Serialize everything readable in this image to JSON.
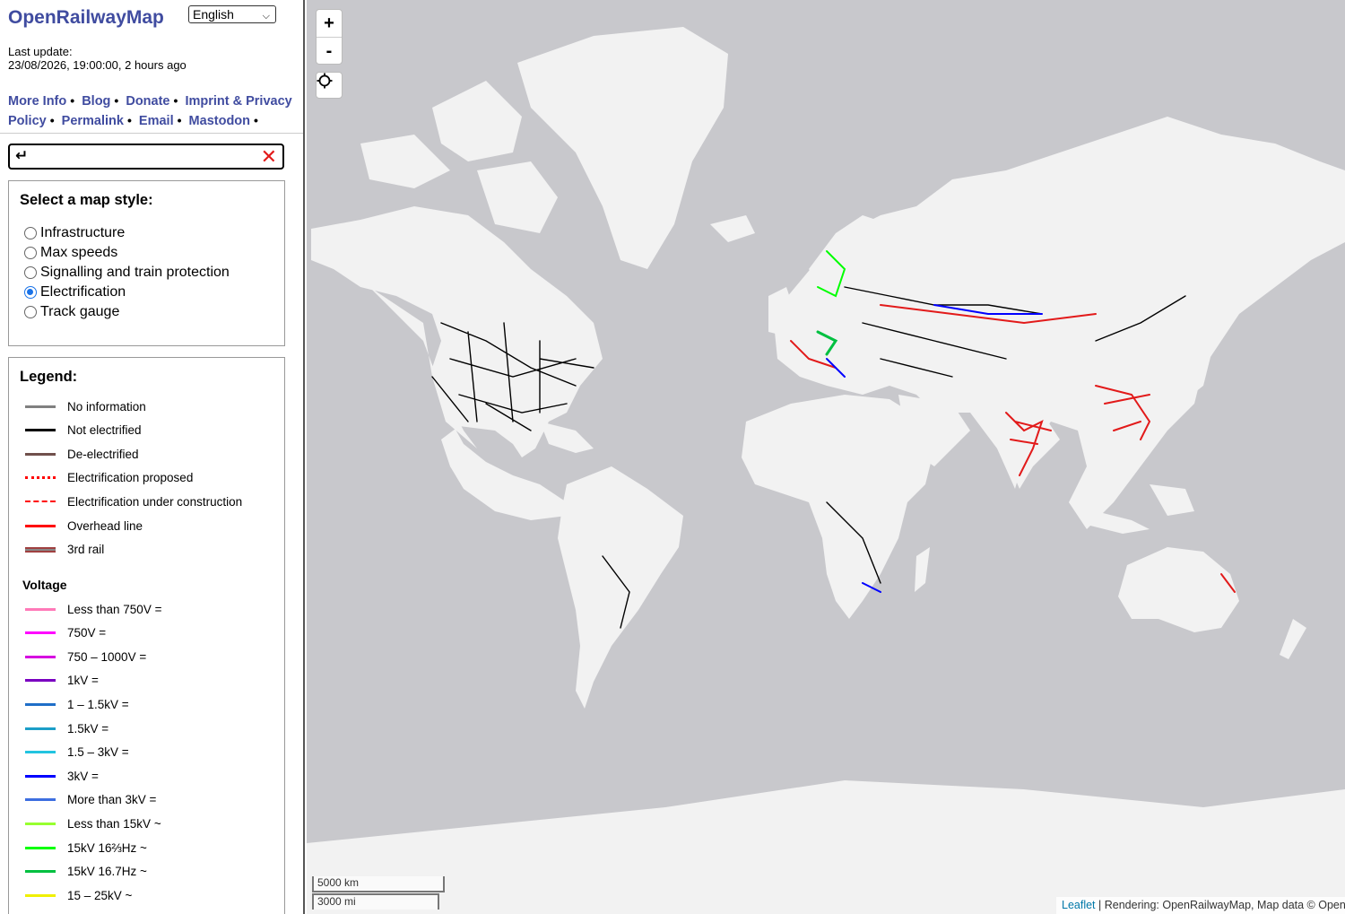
{
  "header": {
    "title": "OpenRailwayMap",
    "language": "English"
  },
  "last_update": {
    "label": "Last update:",
    "value": "23/08/2026, 19:00:00, 2 hours ago"
  },
  "links": [
    "More Info",
    "Blog",
    "Donate",
    "Imprint & Privacy Policy",
    "Permalink",
    "Email",
    "Mastodon"
  ],
  "search": {
    "enter_icon": "↵",
    "value": "",
    "clear_icon": "✕"
  },
  "map_style": {
    "heading": "Select a map style:",
    "options": [
      "Infrastructure",
      "Max speeds",
      "Signalling and train protection",
      "Electrification",
      "Track gauge"
    ],
    "selected": "Electrification"
  },
  "legend": {
    "heading": "Legend:",
    "items": [
      {
        "label": "No information",
        "color": "#808080",
        "style": "solid"
      },
      {
        "label": "Not electrified",
        "color": "#000000",
        "style": "solid"
      },
      {
        "label": "De-electrified",
        "color": "#70504c",
        "style": "solid"
      },
      {
        "label": "Electrification proposed",
        "color": "#ff0000",
        "style": "dotted"
      },
      {
        "label": "Electrification under construction",
        "color": "#ff0000",
        "style": "dashed"
      },
      {
        "label": "Overhead line",
        "color": "#ff0000",
        "style": "solid"
      },
      {
        "label": "3rd rail",
        "color": "#a04040",
        "style": "third"
      }
    ],
    "voltage_heading": "Voltage",
    "voltage_items": [
      {
        "label": "Less than 750V =",
        "color": "#ff79b8"
      },
      {
        "label": "750V =",
        "color": "#ff00ff"
      },
      {
        "label": "750 – 1000V =",
        "color": "#d600e0"
      },
      {
        "label": "1kV =",
        "color": "#7a00c0"
      },
      {
        "label": "1 – 1.5kV =",
        "color": "#1f6fc8"
      },
      {
        "label": "1.5kV =",
        "color": "#1b9ec8"
      },
      {
        "label": "1.5 – 3kV =",
        "color": "#22c4e0"
      },
      {
        "label": "3kV =",
        "color": "#0000ff"
      },
      {
        "label": "More than 3kV =",
        "color": "#3d6ee0"
      },
      {
        "label": "Less than 15kV ~",
        "color": "#97ff2f"
      },
      {
        "label": "15kV 16⅔Hz ~",
        "color": "#00ff00"
      },
      {
        "label": "15kV 16.7Hz ~",
        "color": "#00c040"
      },
      {
        "label": "15 – 25kV ~",
        "color": "#f0f000"
      }
    ]
  },
  "map": {
    "zoom_in": "+",
    "zoom_out": "-",
    "scale_km": "5000 km",
    "scale_mi": "3000 mi",
    "attribution_link": "Leaflet",
    "attribution_text": "| Rendering: OpenRailwayMap, Map data © Open"
  }
}
